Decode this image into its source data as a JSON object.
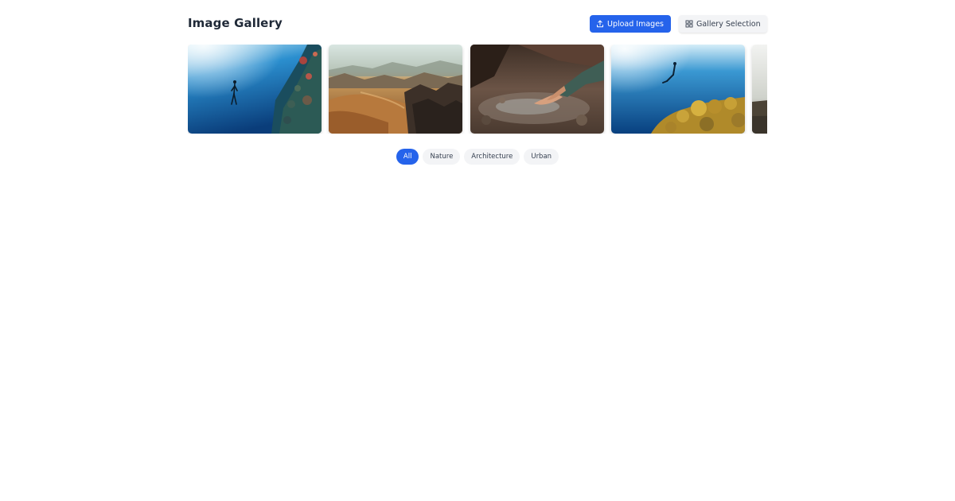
{
  "header": {
    "title": "Image Gallery",
    "upload_label": "Upload Images",
    "gallery_label": "Gallery Selection"
  },
  "gallery": {
    "images": [
      {
        "subject": "Diver in blue ocean beside coral wall",
        "icon": "image-underwater-diver"
      },
      {
        "subject": "Aerial view of desert dunes and rocky mountains",
        "icon": "image-desert-mountains"
      },
      {
        "subject": "Hands scooping water from a rocky stream",
        "icon": "image-hands-water"
      },
      {
        "subject": "Freediver above yellow coral reef",
        "icon": "image-freediver-reef"
      },
      {
        "subject": "Hazy landscape (partially visible)",
        "icon": "image-landscape-partial"
      }
    ]
  },
  "filters": {
    "items": [
      "All",
      "Nature",
      "Architecture",
      "Urban"
    ],
    "active": "All"
  },
  "colors": {
    "accent": "#2563eb",
    "button_secondary_bg": "#f3f4f6",
    "title_text": "#1f2937"
  }
}
